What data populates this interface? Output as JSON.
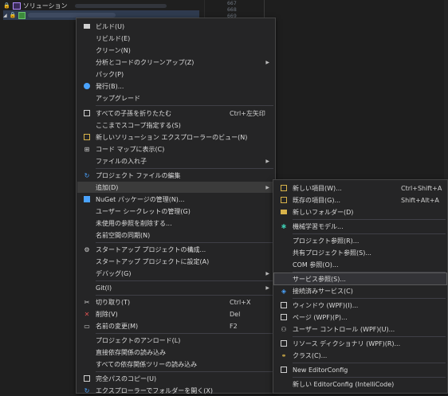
{
  "solution_explorer": {
    "solution_label": "ソリューション"
  },
  "editor": {
    "line_numbers": [
      "667",
      "668",
      "669"
    ]
  },
  "context_menu": {
    "items": [
      {
        "label": "ビルド(U)",
        "icon": "build-icon"
      },
      {
        "label": "リビルド(E)",
        "icon": ""
      },
      {
        "label": "クリーン(N)",
        "icon": ""
      },
      {
        "label": "分析とコードのクリーンアップ(Z)",
        "icon": "",
        "submenu": true
      },
      {
        "label": "パック(P)",
        "icon": ""
      },
      {
        "label": "発行(B)...",
        "icon": "globe-icon"
      },
      {
        "label": "アップグレード",
        "icon": ""
      },
      {
        "label": "すべての子孫を折りたたむ",
        "icon": "collapse-icon",
        "shortcut": "Ctrl+左矢印"
      },
      {
        "label": "ここまでスコープ指定する(S)",
        "icon": ""
      },
      {
        "label": "新しいソリューション エクスプローラーのビュー(N)",
        "icon": "new-view-icon"
      },
      {
        "label": "コード マップに表示(C)",
        "icon": "code-map-icon"
      },
      {
        "label": "ファイルの入れ子",
        "icon": "",
        "submenu": true
      },
      {
        "label": "プロジェクト ファイルの編集",
        "icon": "edit-icon"
      },
      {
        "label": "追加(D)",
        "icon": "",
        "submenu": true
      },
      {
        "label": "NuGet パッケージの管理(N)...",
        "icon": "nuget-icon"
      },
      {
        "label": "ユーザー シークレットの管理(G)",
        "icon": ""
      },
      {
        "label": "未使用の参照を削除する...",
        "icon": ""
      },
      {
        "label": "名前空間の同期(N)",
        "icon": ""
      },
      {
        "label": "スタートアップ プロジェクトの構成...",
        "icon": "gear-icon"
      },
      {
        "label": "スタートアップ プロジェクトに設定(A)",
        "icon": ""
      },
      {
        "label": "デバッグ(G)",
        "icon": "",
        "submenu": true
      },
      {
        "label": "Git(I)",
        "icon": "",
        "submenu": true
      },
      {
        "label": "切り取り(T)",
        "icon": "cut-icon",
        "shortcut": "Ctrl+X"
      },
      {
        "label": "削除(V)",
        "icon": "delete-icon",
        "shortcut": "Del"
      },
      {
        "label": "名前の変更(M)",
        "icon": "rename-icon",
        "shortcut": "F2"
      },
      {
        "label": "プロジェクトのアンロード(L)",
        "icon": ""
      },
      {
        "label": "直接依存関係の読み込み",
        "icon": ""
      },
      {
        "label": "すべての依存関係ツリーの読み込み",
        "icon": ""
      },
      {
        "label": "完全パスのコピー(U)",
        "icon": "copy-icon"
      },
      {
        "label": "エクスプローラーでフォルダーを開く(X)",
        "icon": "refresh-icon"
      }
    ]
  },
  "add_submenu": {
    "items": [
      {
        "label": "新しい項目(W)...",
        "icon": "new-item-icon",
        "shortcut": "Ctrl+Shift+A"
      },
      {
        "label": "既存の項目(G)...",
        "icon": "existing-item-icon",
        "shortcut": "Shift+Alt+A"
      },
      {
        "label": "新しいフォルダー(D)",
        "icon": "folder-icon"
      },
      {
        "label": "機械学習モデル...",
        "icon": "ml-icon"
      },
      {
        "label": "プロジェクト参照(R)...",
        "icon": ""
      },
      {
        "label": "共有プロジェクト参照(S)...",
        "icon": ""
      },
      {
        "label": "COM 参照(O)...",
        "icon": ""
      },
      {
        "label": "サービス参照(S)...",
        "icon": ""
      },
      {
        "label": "接続済みサービス(C)",
        "icon": "connected-service-icon"
      },
      {
        "label": "ウィンドウ (WPF)(I)...",
        "icon": "window-icon"
      },
      {
        "label": "ページ (WPF)(P)...",
        "icon": "page-icon"
      },
      {
        "label": "ユーザー コントロール (WPF)(U)...",
        "icon": "user-control-icon"
      },
      {
        "label": "リソース ディクショナリ (WPF)(R)...",
        "icon": "resource-dictionary-icon"
      },
      {
        "label": "クラス(C)...",
        "icon": "class-icon"
      },
      {
        "label": "New EditorConfig",
        "icon": "editorconfig-icon"
      },
      {
        "label": "新しい EditorConfig (IntelliCode)",
        "icon": ""
      }
    ]
  }
}
